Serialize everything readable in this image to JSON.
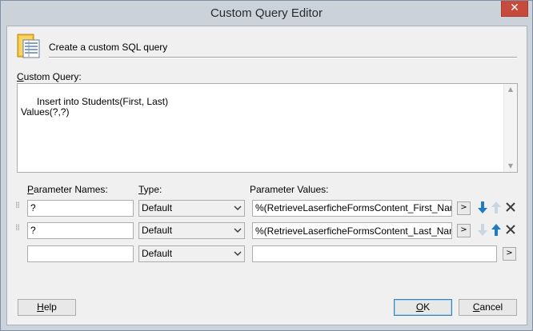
{
  "window": {
    "title": "Custom Query Editor",
    "close_glyph": "✕"
  },
  "header": {
    "icon": "database-book-icon",
    "text": "Create a custom SQL query"
  },
  "query": {
    "label_prefix": "C",
    "label_rest": "ustom Query:",
    "text": "Insert into Students(First, Last)\nValues(?,?)"
  },
  "params": {
    "names_label_prefix": "P",
    "names_label_rest": "arameter Names:",
    "type_label_prefix": "T",
    "type_label_rest": "ype:",
    "values_label": "Parameter Values:",
    "rows": [
      {
        "name": "?",
        "type": "Default",
        "value": "%(RetrieveLaserficheFormsContent_First_Name)",
        "browse": ">"
      },
      {
        "name": "?",
        "type": "Default",
        "value": "%(RetrieveLaserficheFormsContent_Last_Name)",
        "browse": ">"
      },
      {
        "name": "",
        "type": "Default",
        "value": "",
        "browse": ">"
      }
    ]
  },
  "buttons": {
    "help_prefix": "H",
    "help_rest": "elp",
    "ok_prefix": "O",
    "ok_rest": "K",
    "cancel_prefix": "C",
    "cancel_rest": "ancel"
  },
  "colors": {
    "accent_blue": "#1e7bc4",
    "disabled_arrow": "#c8d6e2",
    "close_red": "#c64b3c"
  }
}
